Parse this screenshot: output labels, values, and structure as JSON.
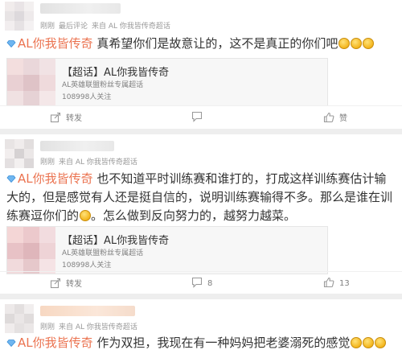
{
  "posts": [
    {
      "meta": {
        "time": "刚刚",
        "type": "最后评论",
        "source": "来自 AL 你我皆传奇超话"
      },
      "tag": "AL你我皆传奇",
      "text": "真希望你们是故意让的，这不是真正的你们吧",
      "card": {
        "title": "【超话】AL你我皆传奇",
        "desc": "AL英雄联盟粉丝专属超话",
        "fans": "108998人关注"
      },
      "actions": {
        "share": "转发",
        "comment": "",
        "like": "赞"
      }
    },
    {
      "meta": {
        "time": "刚刚",
        "type": "",
        "source": "来自 AL 你我皆传奇超话"
      },
      "tag": "AL你我皆传奇",
      "text_a": "也不知道平时训练赛和谁打的，打成这样训练赛估计输大的，但是感觉有人还是挺自信的，说明训练赛输得不多。那么是谁在训练赛逗你们的",
      "text_b": "。怎么做到反向努力的，越努力越菜。",
      "card": {
        "title": "【超话】AL你我皆传奇",
        "desc": "AL英雄联盟粉丝专属超话",
        "fans": "108998人关注"
      },
      "actions": {
        "share": "转发",
        "comment": "8",
        "like": "13"
      }
    },
    {
      "meta": {
        "time": "刚刚",
        "type": "",
        "source": "来自 AL 你我皆传奇超话"
      },
      "tag": "AL你我皆传奇",
      "text": "作为双担，我现在有一种妈妈把老婆溺死的感觉"
    }
  ],
  "colors": {
    "tag": "#eb7350",
    "meta": "#999999",
    "separator": "#eeeeee",
    "card_bg": "#f7f7f7"
  },
  "icons": [
    "gem-icon",
    "smile-emoji",
    "share-icon",
    "comment-icon",
    "like-icon"
  ]
}
